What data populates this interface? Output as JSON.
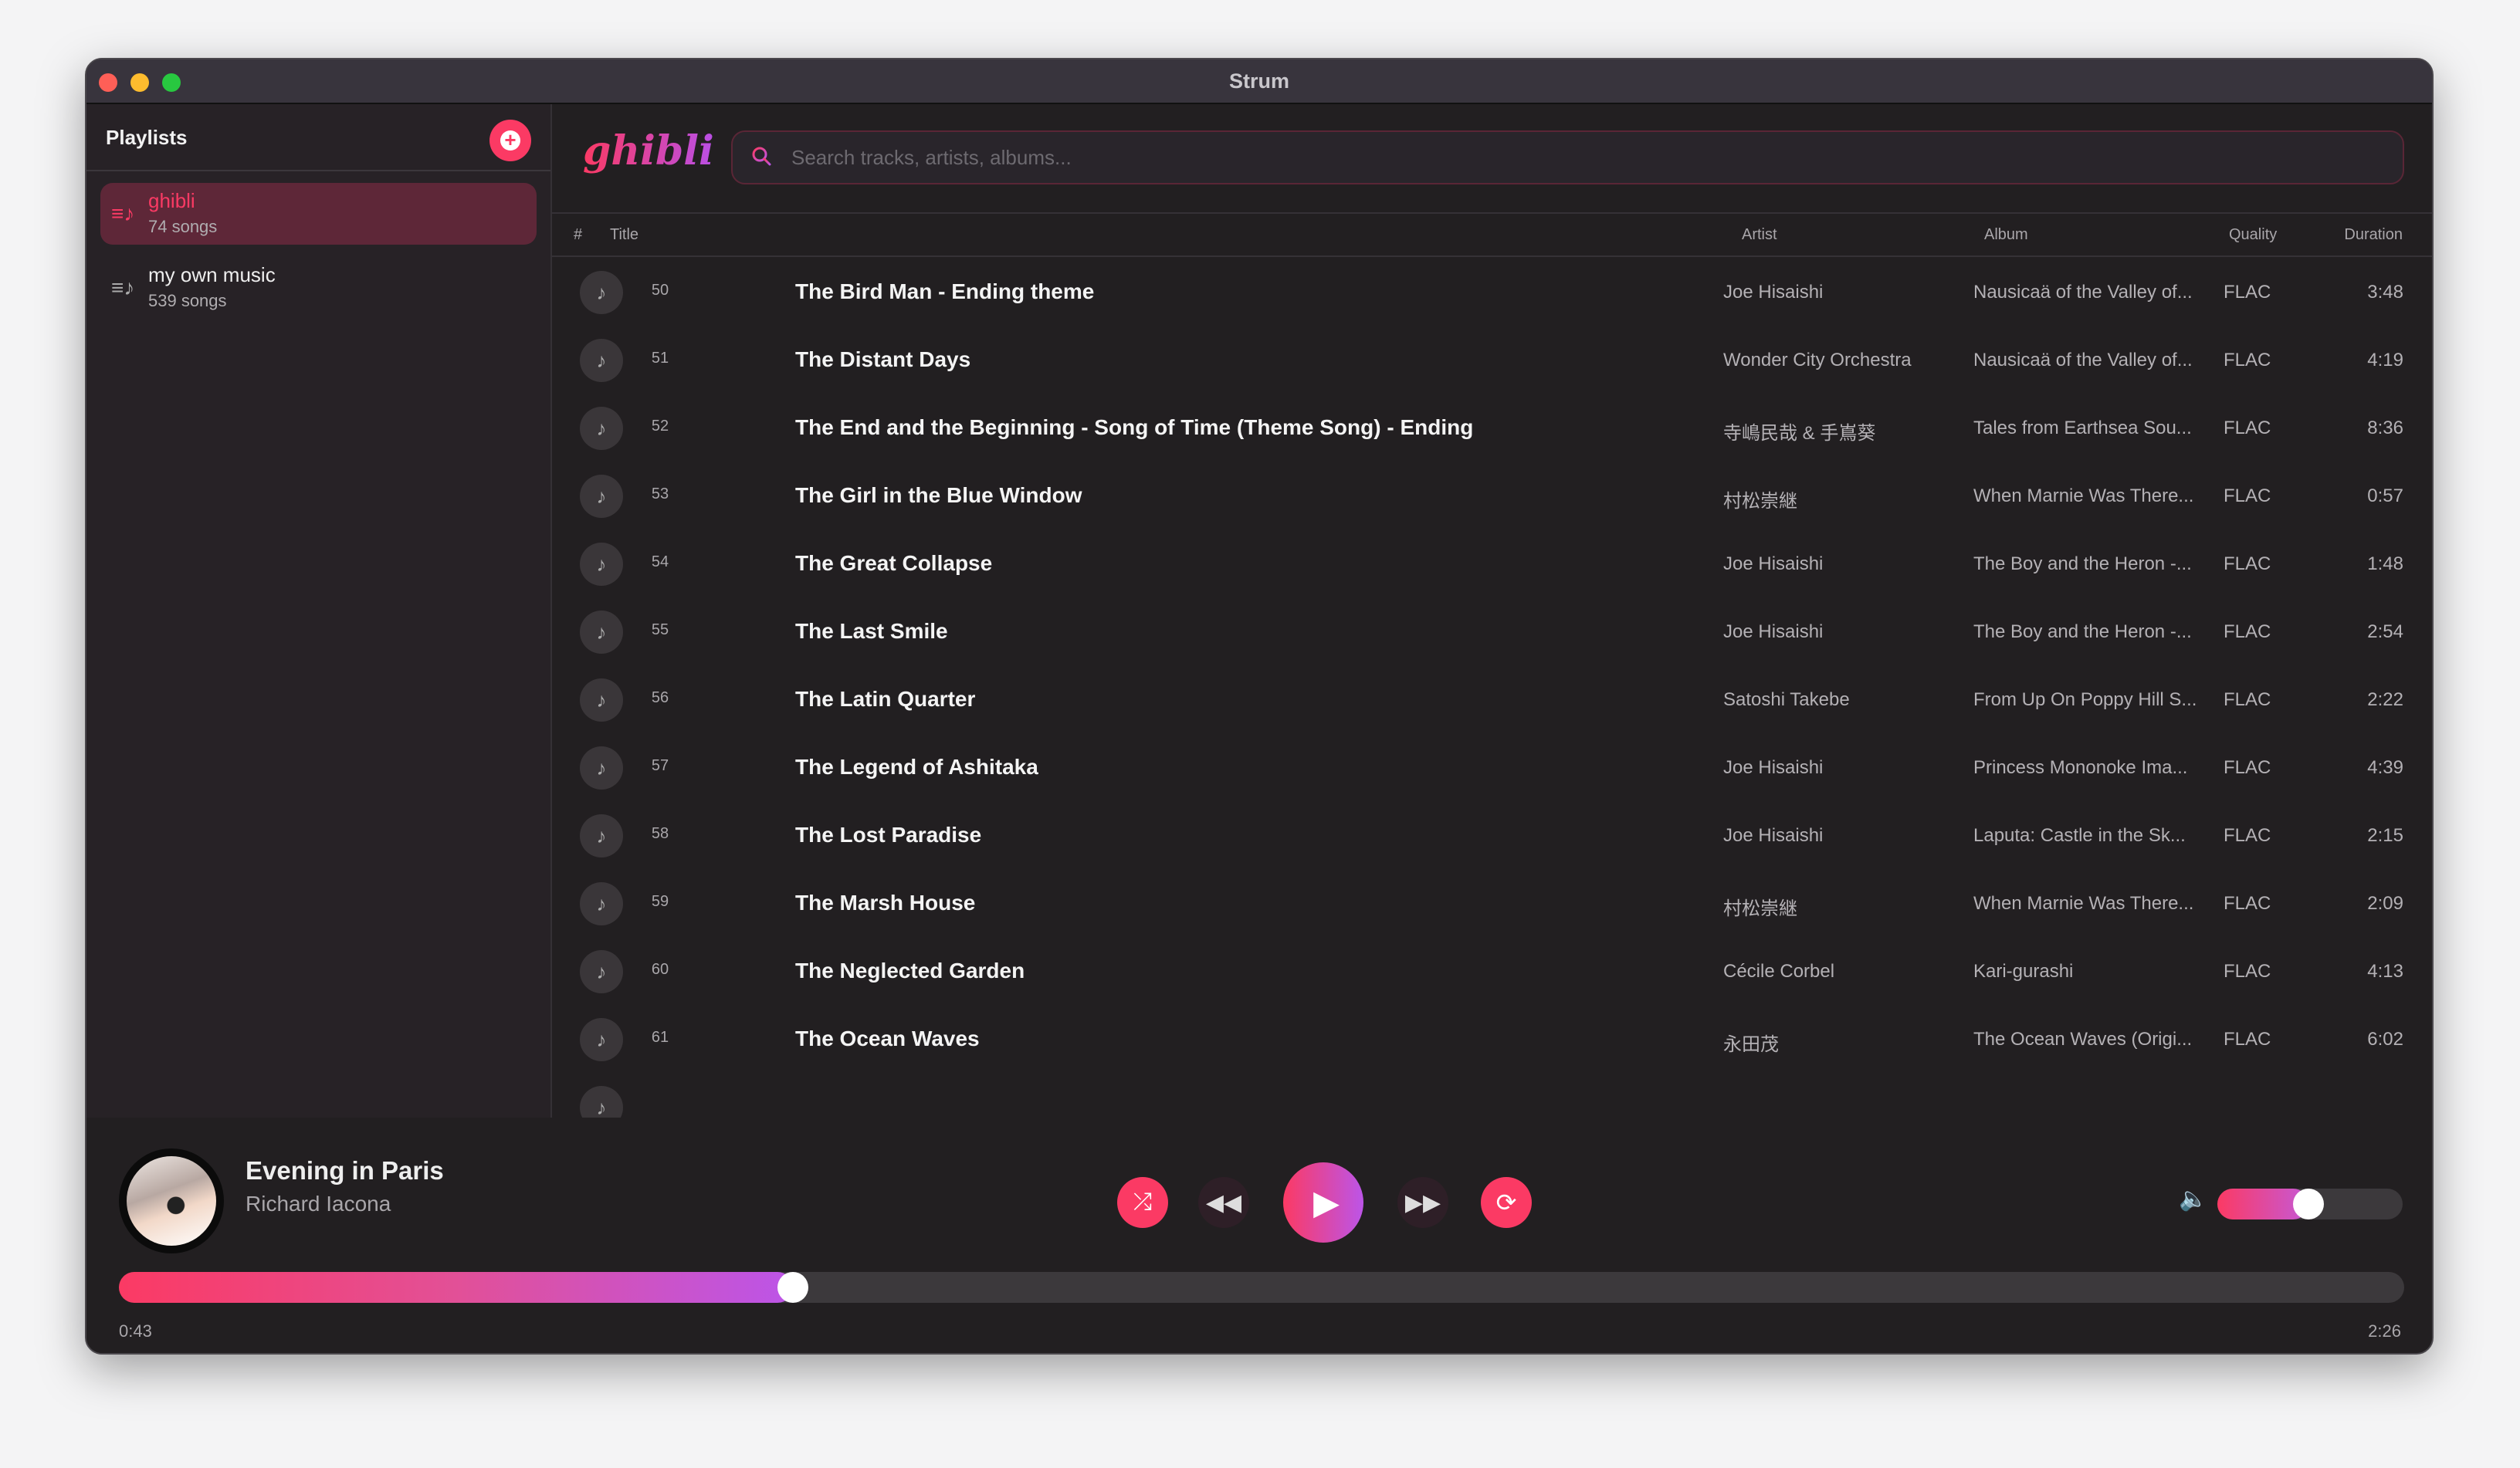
{
  "window": {
    "title": "Strum"
  },
  "sidebar": {
    "title": "Playlists",
    "add_icon": "plus-circle-icon",
    "playlists": [
      {
        "name": "ghibli",
        "count": "74 songs",
        "active": true
      },
      {
        "name": "my own music",
        "count": "539 songs",
        "active": false
      }
    ]
  },
  "header": {
    "logo": "ghibli",
    "search_placeholder": "Search tracks, artists, albums...",
    "search_value": ""
  },
  "table": {
    "columns": {
      "num": "#",
      "title": "Title",
      "artist": "Artist",
      "album": "Album",
      "quality": "Quality",
      "duration": "Duration"
    },
    "rows": [
      {
        "num": "50",
        "title": "The Bird Man - Ending theme",
        "artist": "Joe Hisaishi",
        "album": "Nausicaä of the Valley of...",
        "quality": "FLAC",
        "duration": "3:48"
      },
      {
        "num": "51",
        "title": "The Distant Days",
        "artist": "Wonder City Orchestra",
        "album": "Nausicaä of the Valley of...",
        "quality": "FLAC",
        "duration": "4:19"
      },
      {
        "num": "52",
        "title": "The End and the Beginning - Song of Time (Theme Song) - Ending",
        "artist": "寺嶋民哉 & 手嶌葵",
        "album": "Tales from Earthsea Sou...",
        "quality": "FLAC",
        "duration": "8:36"
      },
      {
        "num": "53",
        "title": "The Girl in the Blue Window",
        "artist": "村松崇継",
        "album": "When Marnie Was There...",
        "quality": "FLAC",
        "duration": "0:57"
      },
      {
        "num": "54",
        "title": "The Great Collapse",
        "artist": "Joe Hisaishi",
        "album": "The Boy and the Heron -...",
        "quality": "FLAC",
        "duration": "1:48"
      },
      {
        "num": "55",
        "title": "The Last Smile",
        "artist": "Joe Hisaishi",
        "album": "The Boy and the Heron -...",
        "quality": "FLAC",
        "duration": "2:54"
      },
      {
        "num": "56",
        "title": "The Latin Quarter",
        "artist": "Satoshi Takebe",
        "album": "From Up On Poppy Hill S...",
        "quality": "FLAC",
        "duration": "2:22"
      },
      {
        "num": "57",
        "title": "The Legend of Ashitaka",
        "artist": "Joe Hisaishi",
        "album": "Princess Mononoke Ima...",
        "quality": "FLAC",
        "duration": "4:39"
      },
      {
        "num": "58",
        "title": "The Lost Paradise",
        "artist": "Joe Hisaishi",
        "album": "Laputa: Castle in the Sk...",
        "quality": "FLAC",
        "duration": "2:15"
      },
      {
        "num": "59",
        "title": "The Marsh House",
        "artist": "村松崇継",
        "album": "When Marnie Was There...",
        "quality": "FLAC",
        "duration": "2:09"
      },
      {
        "num": "60",
        "title": "The Neglected Garden",
        "artist": "Cécile Corbel",
        "album": "Kari-gurashi",
        "quality": "FLAC",
        "duration": "4:13"
      },
      {
        "num": "61",
        "title": "The Ocean Waves",
        "artist": "永田茂",
        "album": "The Ocean Waves (Origi...",
        "quality": "FLAC",
        "duration": "6:02"
      }
    ]
  },
  "player": {
    "title": "Evening in Paris",
    "artist": "Richard Iacona",
    "current_time": "0:43",
    "total_time": "2:26",
    "progress": 0.295,
    "volume": 0.49,
    "icons": [
      "shuffle-icon",
      "rewind-icon",
      "play-icon",
      "fast-forward-icon",
      "repeat-icon",
      "volume-icon"
    ]
  },
  "colors": {
    "accent": "#fb3a64",
    "accent2": "#bc55e8",
    "background": "#221f21",
    "sidebar": "#272226",
    "active_playlist": "#5e2738"
  }
}
